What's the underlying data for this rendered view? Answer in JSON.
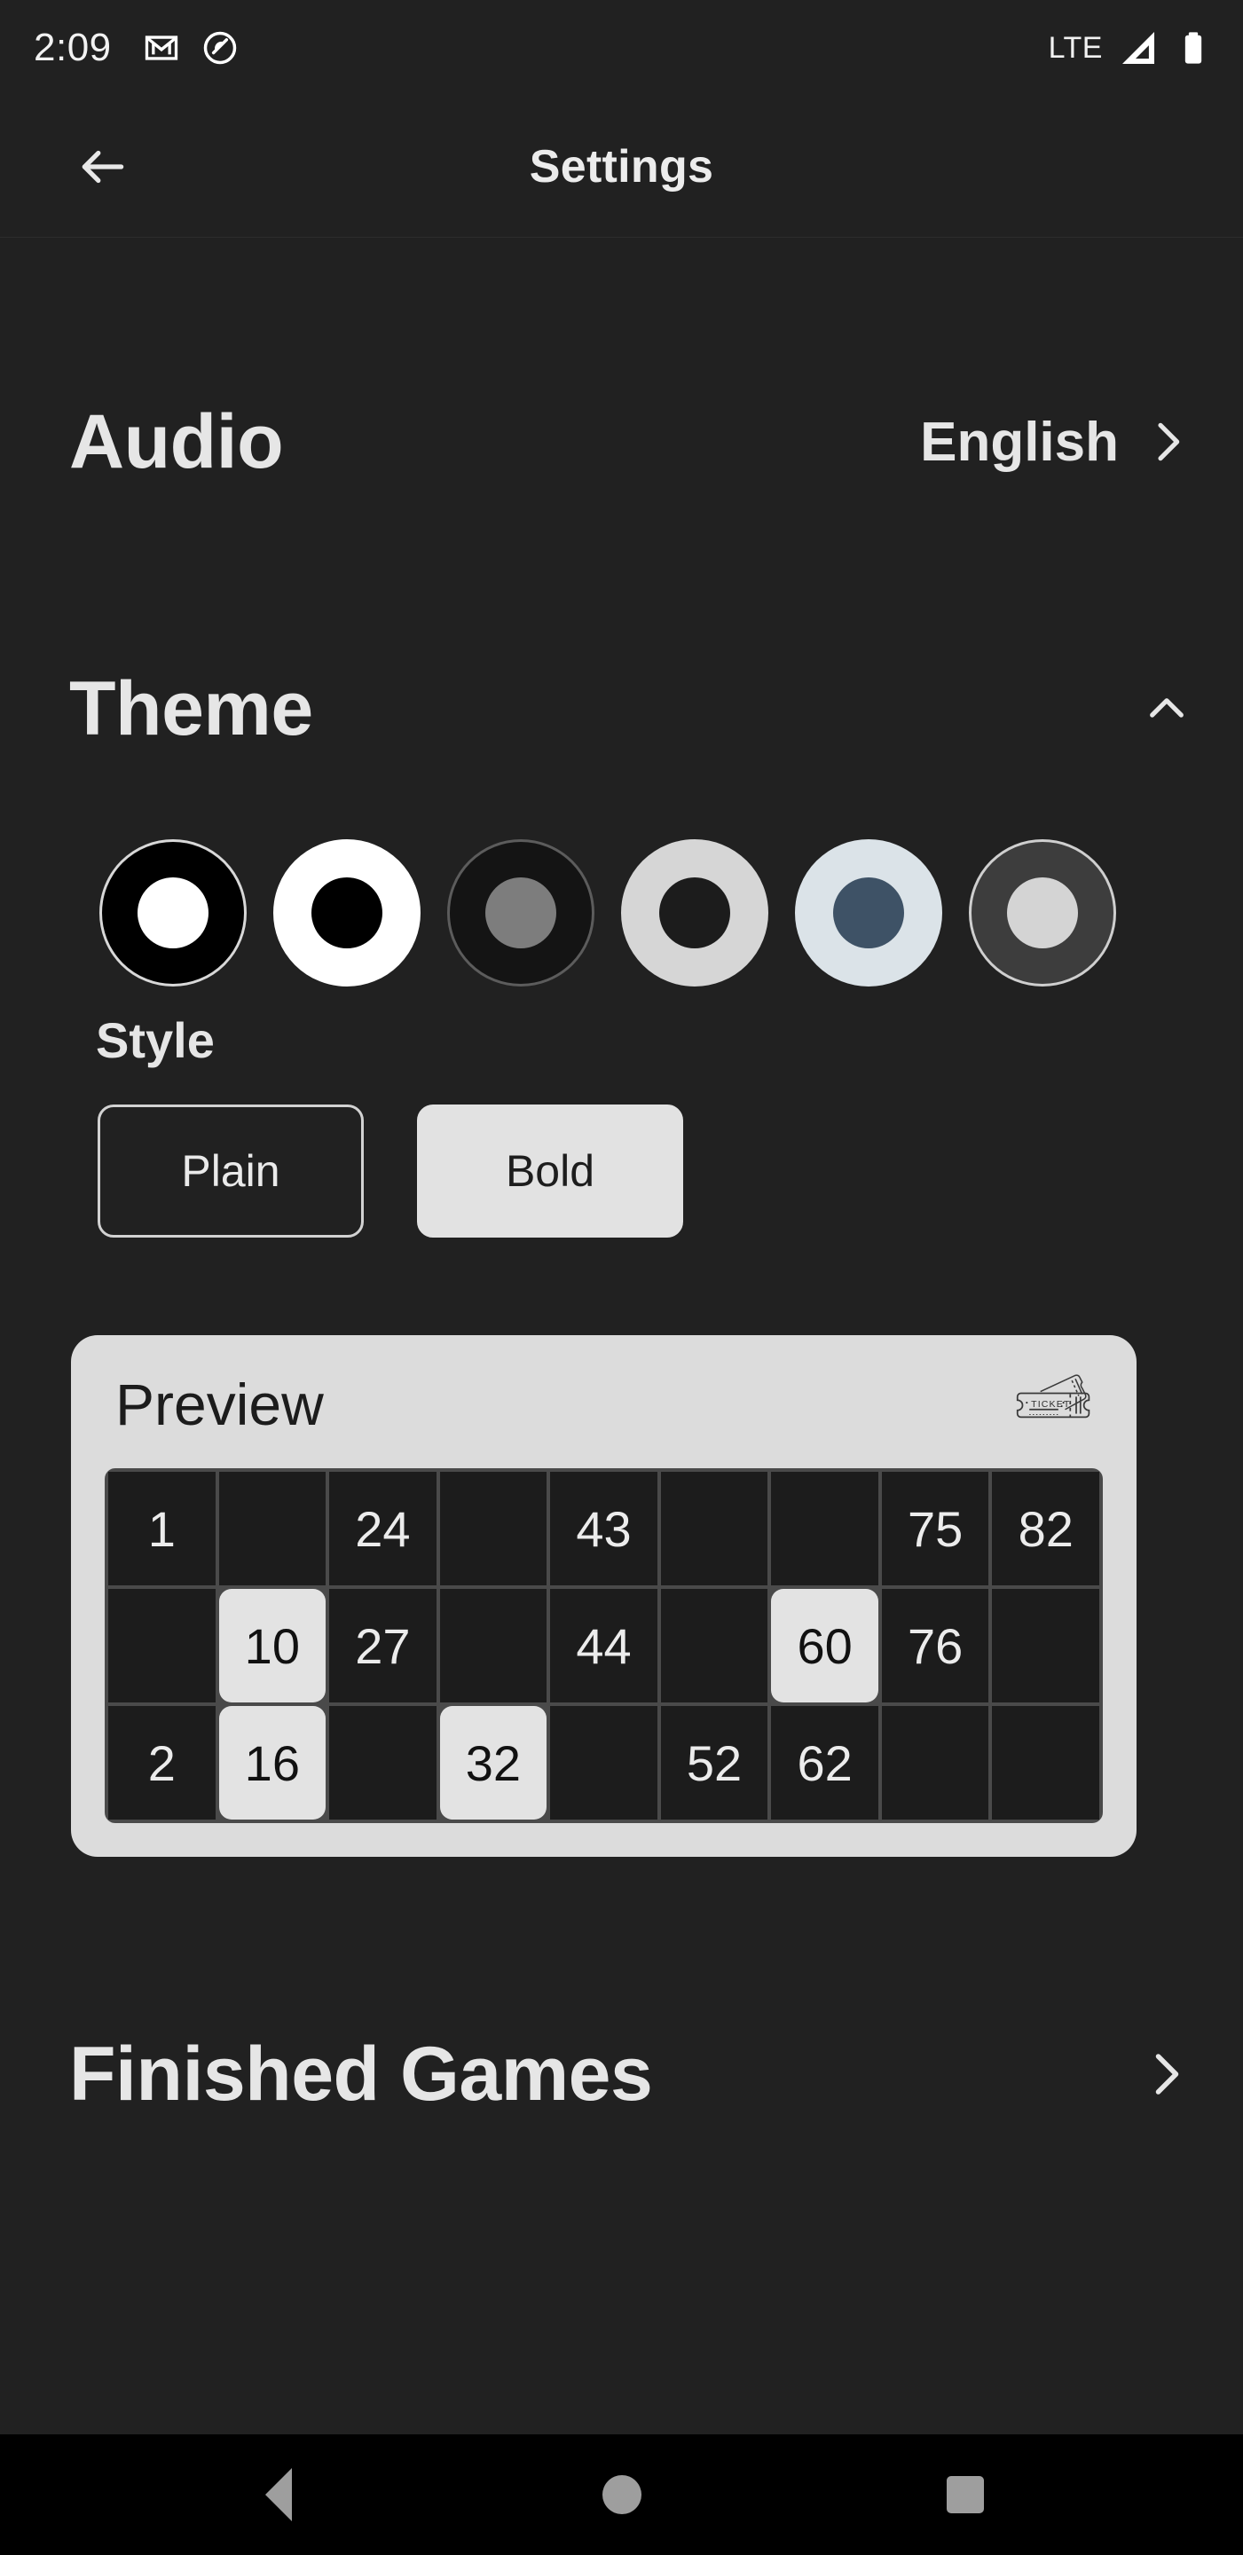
{
  "status_bar": {
    "time": "2:09",
    "network_label": "LTE",
    "icons": [
      "gmail-icon",
      "do-not-disturb-icon",
      "signal-icon",
      "battery-icon"
    ]
  },
  "app_bar": {
    "back_icon": "arrow-left-icon",
    "title": "Settings"
  },
  "sections": {
    "audio": {
      "label": "Audio",
      "value": "English",
      "chevron": "chevron-right-icon"
    },
    "theme": {
      "label": "Theme",
      "chevron": "chevron-up-icon",
      "expanded": true,
      "swatches": [
        {
          "name": "theme-black-white",
          "outer": "#000000",
          "inner": "#ffffff",
          "border": "#d8d8d8",
          "selected": false
        },
        {
          "name": "theme-white-black",
          "outer": "#ffffff",
          "inner": "#000000",
          "border": "#ffffff",
          "selected": false
        },
        {
          "name": "theme-dark-gray",
          "outer": "#141414",
          "inner": "#7d7d7d",
          "border": "#5c5c5c",
          "selected": false
        },
        {
          "name": "theme-light-dark",
          "outer": "#d6d6d6",
          "inner": "#1c1c1c",
          "border": "#d6d6d6",
          "selected": false
        },
        {
          "name": "theme-blue-slate",
          "outer": "#dbe3e8",
          "inner": "#3e5266",
          "border": "#dbe3e8",
          "selected": true
        },
        {
          "name": "theme-gray-light",
          "outer": "#3d3d3d",
          "inner": "#d4d4d4",
          "border": "#cfcfcf",
          "selected": false
        }
      ],
      "style": {
        "label": "Style",
        "options": [
          {
            "label": "Plain",
            "selected": false
          },
          {
            "label": "Bold",
            "selected": true
          }
        ]
      },
      "preview": {
        "title": "Preview",
        "icon": "ticket-icon",
        "ticket_text": "TICKET",
        "grid": {
          "columns": 9,
          "rows": 3,
          "cells": [
            [
              {
                "value": "1",
                "marked": false
              },
              {
                "value": "",
                "marked": false
              },
              {
                "value": "24",
                "marked": false
              },
              {
                "value": "",
                "marked": false
              },
              {
                "value": "43",
                "marked": false
              },
              {
                "value": "",
                "marked": false
              },
              {
                "value": "",
                "marked": false
              },
              {
                "value": "75",
                "marked": false
              },
              {
                "value": "82",
                "marked": false
              }
            ],
            [
              {
                "value": "",
                "marked": false
              },
              {
                "value": "10",
                "marked": true
              },
              {
                "value": "27",
                "marked": false
              },
              {
                "value": "",
                "marked": false
              },
              {
                "value": "44",
                "marked": false
              },
              {
                "value": "",
                "marked": false
              },
              {
                "value": "60",
                "marked": true
              },
              {
                "value": "76",
                "marked": false
              },
              {
                "value": "",
                "marked": false
              }
            ],
            [
              {
                "value": "2",
                "marked": false
              },
              {
                "value": "16",
                "marked": true
              },
              {
                "value": "",
                "marked": false
              },
              {
                "value": "32",
                "marked": true
              },
              {
                "value": "",
                "marked": false
              },
              {
                "value": "52",
                "marked": false
              },
              {
                "value": "62",
                "marked": false
              },
              {
                "value": "",
                "marked": false
              },
              {
                "value": "",
                "marked": false
              }
            ]
          ]
        }
      }
    },
    "finished_games": {
      "label": "Finished Games",
      "chevron": "chevron-right-icon"
    }
  },
  "nav_bar": {
    "items": [
      {
        "name": "nav-back-button",
        "icon": "triangle-back-icon"
      },
      {
        "name": "nav-home-button",
        "icon": "circle-home-icon"
      },
      {
        "name": "nav-recents-button",
        "icon": "square-recents-icon"
      }
    ]
  },
  "colors": {
    "page_background": "#212121",
    "card_background": "#dcdcdc",
    "grid_background": "#4a4a4a",
    "cell_background": "#1c1c1c",
    "marked_cell": "#e3e3e3",
    "text_primary": "#e6e6e6",
    "nav_bar": "#000000",
    "nav_icon": "#9e9e9e"
  }
}
